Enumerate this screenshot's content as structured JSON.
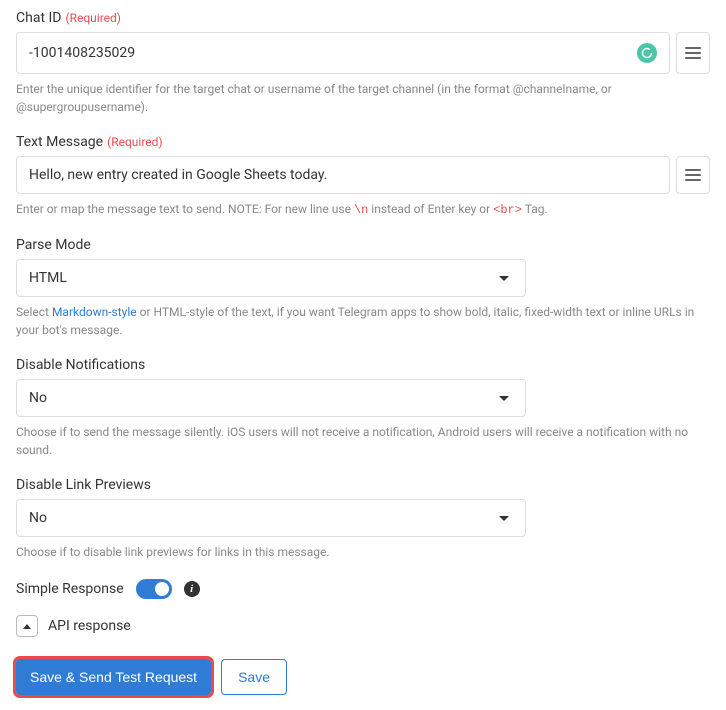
{
  "chatId": {
    "label": "Chat ID",
    "required": "(Required)",
    "value": "-1001408235029",
    "help": "Enter the unique identifier for the target chat or username of the target channel (in the format @channelname, or @supergroupusername)."
  },
  "textMessage": {
    "label": "Text Message",
    "required": "(Required)",
    "value": "Hello, new entry created in Google Sheets today.",
    "helpPrefix": "Enter or map the message text to send. NOTE: For new line use ",
    "helpCode1": "\\n",
    "helpMid": " instead of Enter key or ",
    "helpCode2": "<br>",
    "helpSuffix": " Tag."
  },
  "parseMode": {
    "label": "Parse Mode",
    "value": "HTML",
    "helpPrefix": "Select ",
    "helpLink": "Markdown-style",
    "helpSuffix": " or HTML-style of the text, if you want Telegram apps to show bold, italic, fixed-width text or inline URLs in your bot's message."
  },
  "disableNotifications": {
    "label": "Disable Notifications",
    "value": "No",
    "help": "Choose if to send the message silently. iOS users will not receive a notification, Android users will receive a notification with no sound."
  },
  "disableLinkPreviews": {
    "label": "Disable Link Previews",
    "value": "No",
    "help": "Choose if to disable link previews for links in this message."
  },
  "simpleResponse": {
    "label": "Simple Response"
  },
  "apiResponse": {
    "label": "API response"
  },
  "buttons": {
    "saveTest": "Save & Send Test Request",
    "save": "Save"
  }
}
